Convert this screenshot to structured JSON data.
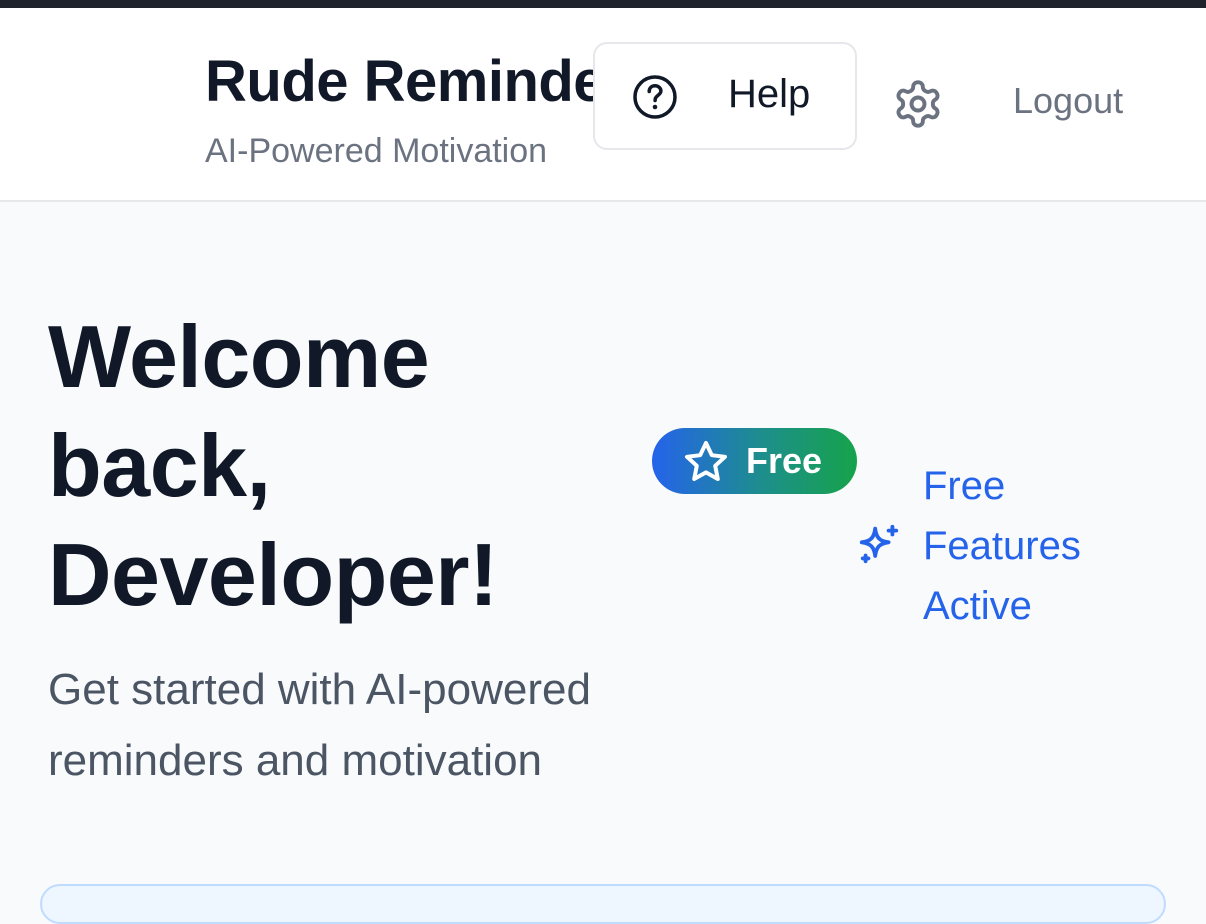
{
  "header": {
    "title": "Rude Reminder",
    "subtitle": "AI-Powered Motivation",
    "help_label": "Help",
    "help_icon": "help-circle-icon",
    "settings_icon": "gear-icon",
    "logout_label": "Logout"
  },
  "main": {
    "welcome_heading": "Welcome back, Developer!",
    "welcome_subtext": "Get started with AI-powered reminders and motivation",
    "plan_badge": {
      "label": "Free",
      "icon": "star-icon"
    },
    "features_status": {
      "text": "Free Features Active",
      "icon": "sparkles-icon"
    }
  },
  "colors": {
    "accent_blue": "#2563eb",
    "accent_green": "#16a34a",
    "text_dark": "#111827",
    "text_muted": "#6b7280",
    "background": "#f8fafc"
  }
}
